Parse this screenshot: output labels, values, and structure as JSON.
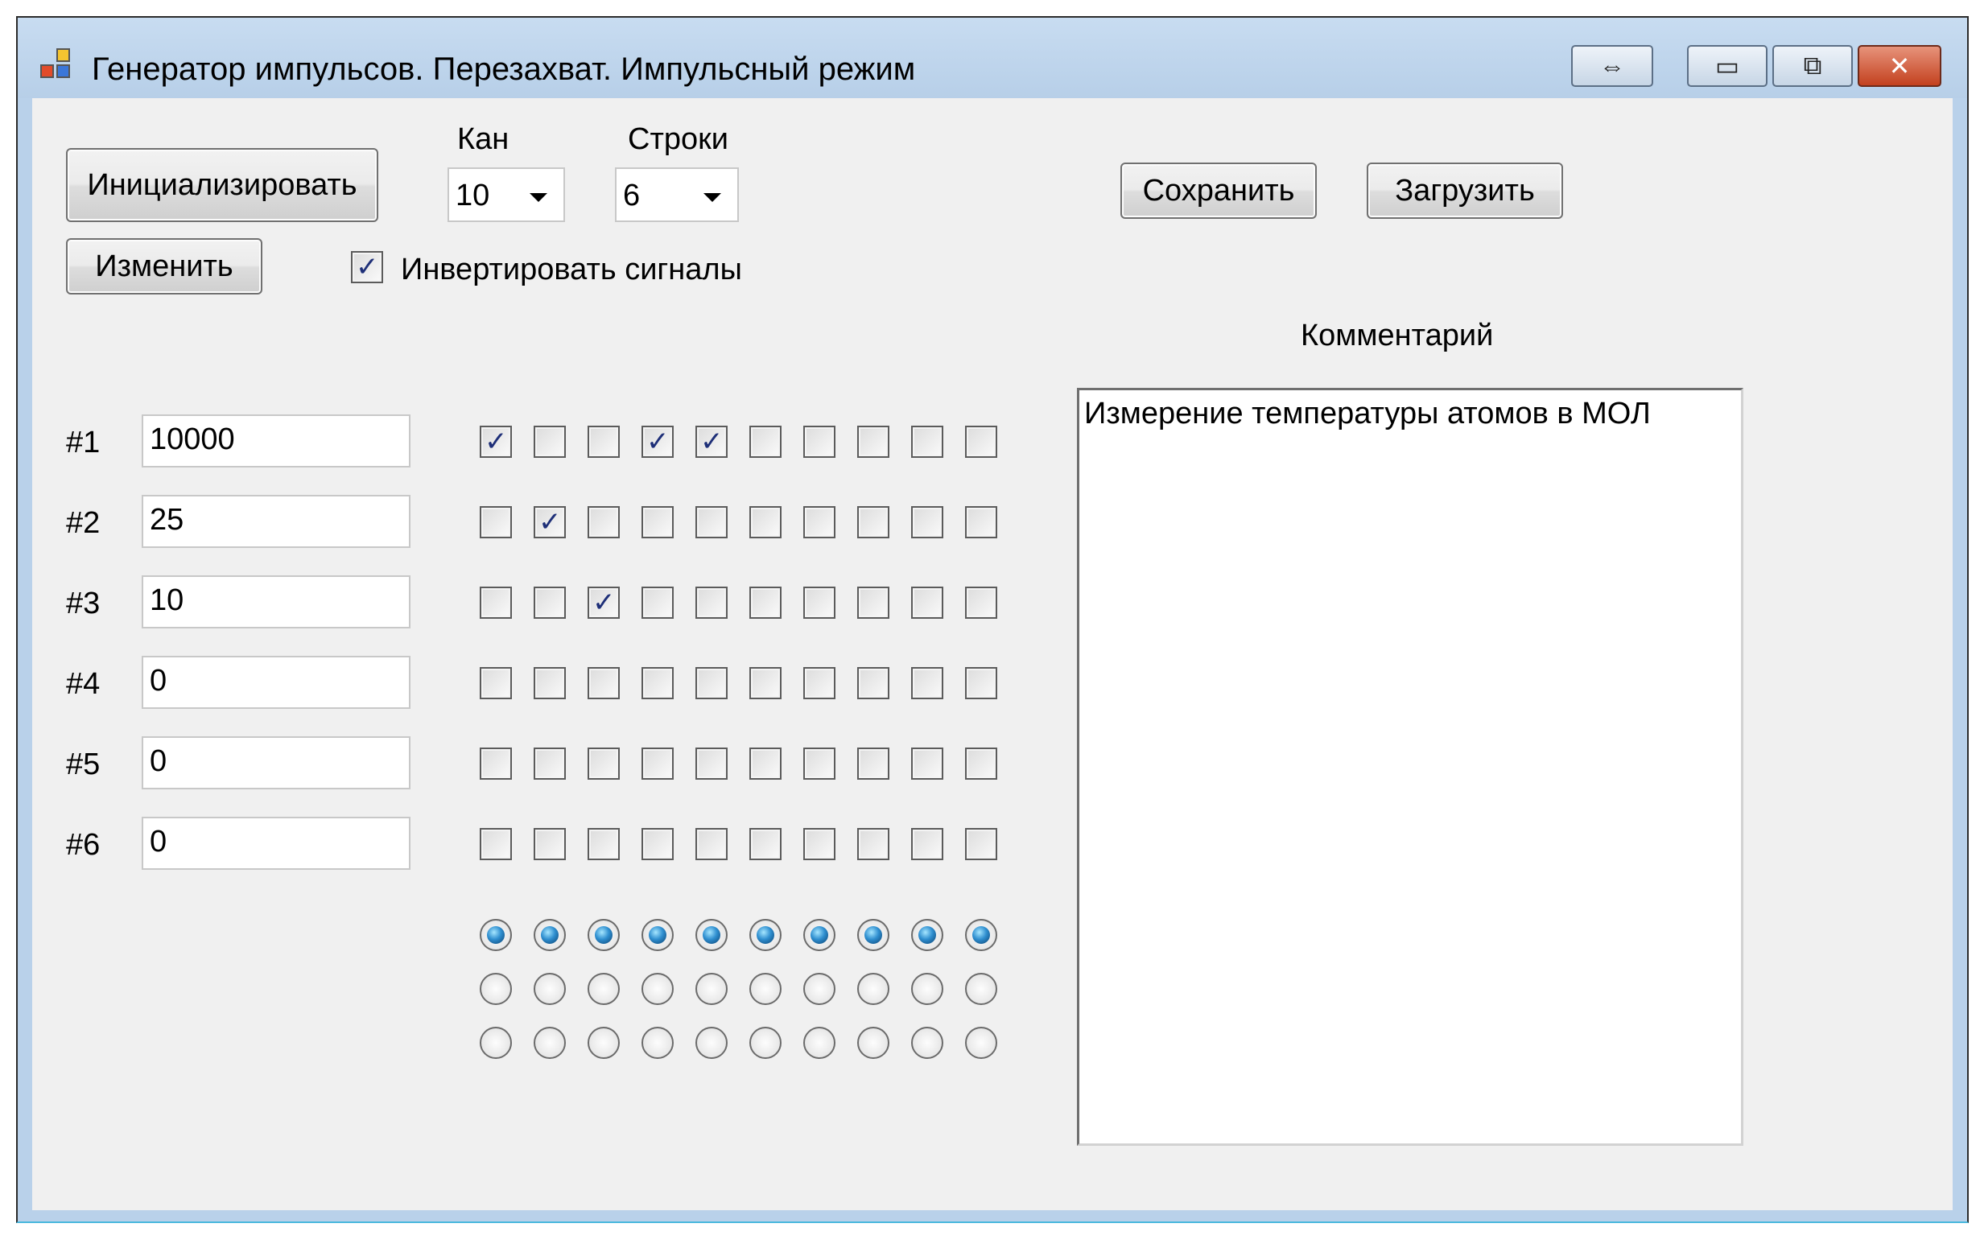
{
  "window": {
    "title": "Генератор импульсов. Перезахват. Импульсный режим",
    "caption_icons": [
      "swap-horizontal-icon",
      "minimize-icon",
      "restore-icon",
      "close-icon"
    ],
    "caption_glyphs": [
      "⇔",
      "▭",
      "⧉",
      "✕"
    ]
  },
  "toolbar": {
    "init_label": "Инициализировать",
    "change_label": "Изменить",
    "save_label": "Сохранить",
    "load_label": "Загрузить",
    "invert_label": "Инвертировать сигналы",
    "invert_checked": true
  },
  "channels": {
    "label": "Кан",
    "value": "10"
  },
  "rows_select": {
    "label": "Строки",
    "value": "6"
  },
  "rows": [
    {
      "label": "#1",
      "value": "10000",
      "checks": [
        true,
        false,
        false,
        true,
        true,
        false,
        false,
        false,
        false,
        false
      ]
    },
    {
      "label": "#2",
      "value": "25",
      "checks": [
        false,
        true,
        false,
        false,
        false,
        false,
        false,
        false,
        false,
        false
      ]
    },
    {
      "label": "#3",
      "value": "10",
      "checks": [
        false,
        false,
        true,
        false,
        false,
        false,
        false,
        false,
        false,
        false
      ]
    },
    {
      "label": "#4",
      "value": "0",
      "checks": [
        false,
        false,
        false,
        false,
        false,
        false,
        false,
        false,
        false,
        false
      ]
    },
    {
      "label": "#5",
      "value": "0",
      "checks": [
        false,
        false,
        false,
        false,
        false,
        false,
        false,
        false,
        false,
        false
      ]
    },
    {
      "label": "#6",
      "value": "0",
      "checks": [
        false,
        false,
        false,
        false,
        false,
        false,
        false,
        false,
        false,
        false
      ]
    }
  ],
  "radio_selected_row": [
    0,
    0,
    0,
    0,
    0,
    0,
    0,
    0,
    0,
    0
  ],
  "radio_row_count": 3,
  "comment": {
    "label": "Комментарий",
    "text": "Измерение температуры атомов в МОЛ"
  },
  "colors": {
    "check_mark": "#1e2f78",
    "radio_selected": "#2f8fd0",
    "titlebar": "#b9d1ea"
  }
}
